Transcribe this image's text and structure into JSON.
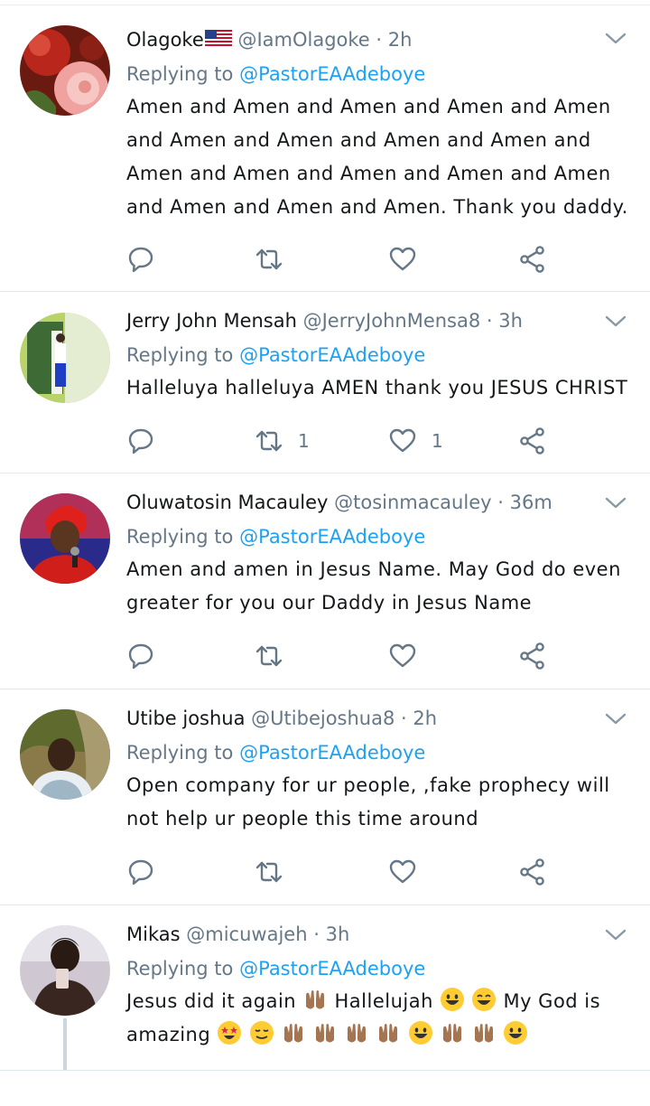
{
  "tweets": [
    {
      "name": "Olagoke",
      "handle": "@IamOlagoke",
      "dot": "·",
      "time": "2h",
      "replying_prefix": "Replying to",
      "replying_to": "@PastorEAAdeboye",
      "text": "Amen and Amen and Amen and Amen and Amen and Amen and Amen and Amen and Amen and Amen and Amen and Amen and Amen and Amen and Amen and Amen and Amen. Thank you daddy.",
      "retweets": "",
      "likes": ""
    },
    {
      "name": "Jerry John Mensah",
      "handle": "@JerryJohnMensa8",
      "dot": "·",
      "time": "3h",
      "replying_prefix": "Replying to",
      "replying_to": "@PastorEAAdeboye",
      "text": "Halleluya halleluya AMEN thank you JESUS CHRIST",
      "retweets": "1",
      "likes": "1"
    },
    {
      "name": "Oluwatosin Macauley",
      "handle": "@tosinmacauley",
      "dot": "·",
      "time": "36m",
      "replying_prefix": "Replying to",
      "replying_to": "@PastorEAAdeboye",
      "text": "Amen and amen in Jesus Name. May God do even greater for you our Daddy in Jesus Name",
      "retweets": "",
      "likes": ""
    },
    {
      "name": "Utibe joshua",
      "handle": "@Utibejoshua8",
      "dot": "·",
      "time": "2h",
      "replying_prefix": "Replying to",
      "replying_to": "@PastorEAAdeboye",
      "text": "Open company for ur people, ,fake prophecy will not help ur people this time around",
      "retweets": "",
      "likes": ""
    },
    {
      "name": "Mikas",
      "handle": "@micuwajeh",
      "dot": "·",
      "time": "3h",
      "replying_prefix": "Replying to",
      "replying_to": "@PastorEAAdeboye",
      "text_part1": "Jesus did it again",
      "text_part2": "Hallelujah",
      "text_part3": "My God is",
      "text_part4": "amazing",
      "retweets": "",
      "likes": ""
    }
  ],
  "icons": {
    "reply": "reply-icon",
    "retweet": "retweet-icon",
    "like": "heart-icon",
    "share": "share-icon",
    "menu": "chevron-down-icon"
  },
  "colors": {
    "link": "#1da1f2",
    "muted": "#657786",
    "text": "#14171a",
    "divider": "#e1e8ed"
  }
}
